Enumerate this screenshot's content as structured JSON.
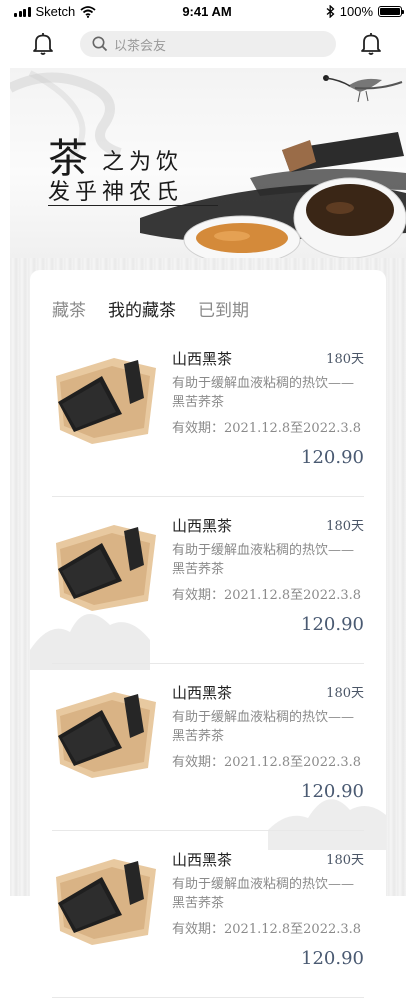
{
  "status_bar": {
    "carrier": "Sketch",
    "time": "9:41 AM",
    "battery": "100%"
  },
  "search": {
    "placeholder": "以茶会友"
  },
  "banner": {
    "big_char": "茶",
    "line1": "之为饮",
    "line2": "发乎神农氏"
  },
  "tabs": [
    {
      "label": "藏茶",
      "active": false
    },
    {
      "label": "我的藏茶",
      "active": true
    },
    {
      "label": "已到期",
      "active": false
    }
  ],
  "items": [
    {
      "name": "山西黑茶",
      "days": "180天",
      "desc": "有助于缓解血液粘稠的热饮——黑苦荞茶",
      "expiry": "有效期：2021.12.8至2022.3.8",
      "price": "120.90"
    },
    {
      "name": "山西黑茶",
      "days": "180天",
      "desc": "有助于缓解血液粘稠的热饮——黑苦荞茶",
      "expiry": "有效期：2021.12.8至2022.3.8",
      "price": "120.90"
    },
    {
      "name": "山西黑茶",
      "days": "180天",
      "desc": "有助于缓解血液粘稠的热饮——黑苦荞茶",
      "expiry": "有效期：2021.12.8至2022.3.8",
      "price": "120.90"
    },
    {
      "name": "山西黑茶",
      "days": "180天",
      "desc": "有助于缓解血液粘稠的热饮——黑苦荞茶",
      "expiry": "有效期：2021.12.8至2022.3.8",
      "price": "120.90"
    }
  ],
  "icons": {
    "notification_left": "bell-icon",
    "notification_right": "bell-icon",
    "search": "search-icon",
    "wifi": "wifi-icon",
    "bluetooth": "bluetooth-icon"
  },
  "colors": {
    "price": "#4a5a72",
    "tab_active": "#222222",
    "tab_inactive": "#8a8a8a",
    "search_bg": "#eeeeee"
  }
}
